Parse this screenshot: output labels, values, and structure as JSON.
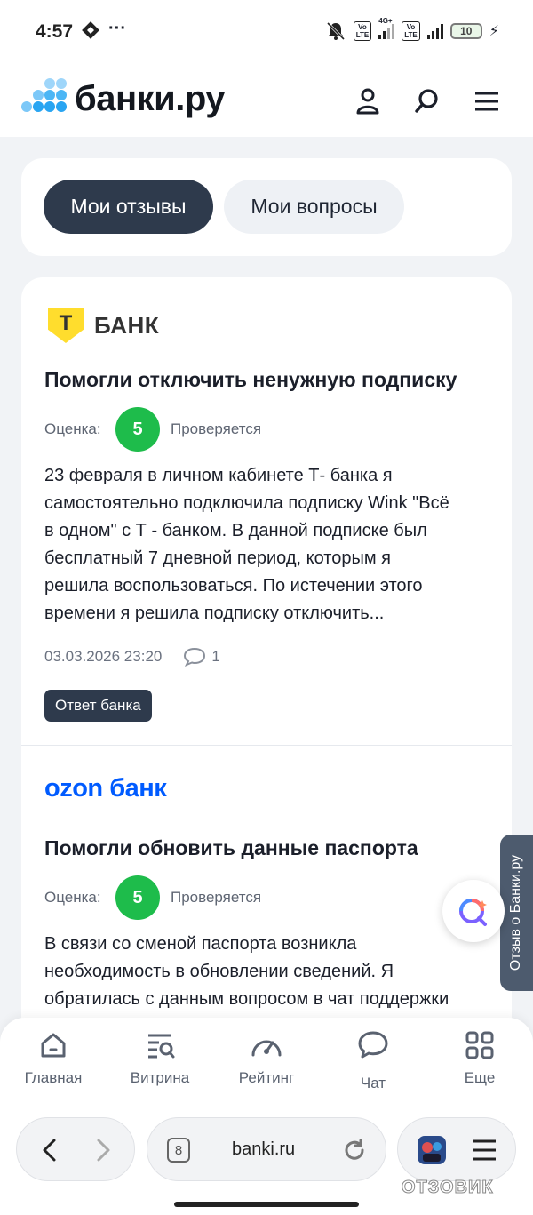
{
  "status_bar": {
    "time": "4:57",
    "dots": "···",
    "battery": "10",
    "network": "4G+"
  },
  "site": {
    "name": "банки.ру"
  },
  "tabs": [
    {
      "label": "Мои отзывы",
      "active": true
    },
    {
      "label": "Мои вопросы",
      "active": false
    }
  ],
  "reviews": [
    {
      "bank_logo": "T-Bank",
      "bank_name": "БАНК",
      "bank_letter": "Т",
      "title": "Помогли отключить ненужную подписку",
      "rating_label": "Оценка:",
      "rating": "5",
      "status": "Проверяется",
      "text_lines": [
        "23 февраля в личном кабинете Т- банка я",
        "самостоятельно подключила подписку Wink \"Всё",
        "в одном\" с Т - банком. В данной подписке был",
        "бесплатный 7 дневной период, которым я",
        "решила воспользоваться. По истечении этого",
        "времени я решила подписку отключить..."
      ],
      "date": "03.03.2026 23:20",
      "comments": "1",
      "badge": "Ответ банка"
    },
    {
      "bank_logo": "ozon банк",
      "title": "Помогли обновить данные паспорта",
      "rating_label": "Оценка:",
      "rating": "5",
      "status": "Проверяется",
      "text_lines": [
        "В связи со сменой паспорта возникла",
        "необходимость в обновлении сведений. Я",
        "обратилась с данным вопросом в чат поддержки"
      ]
    }
  ],
  "side_tab": "Отзыв о Банки.ру",
  "bottom_nav": [
    {
      "label": "Главная",
      "icon": "home-icon"
    },
    {
      "label": "Витрина",
      "icon": "showcase-icon"
    },
    {
      "label": "Рейтинг",
      "icon": "gauge-icon"
    },
    {
      "label": "Чат",
      "icon": "chat-icon"
    },
    {
      "label": "Еще",
      "icon": "grid-icon"
    }
  ],
  "browser": {
    "url": "banki.ru",
    "tab_count": "8"
  },
  "watermark": "ОТЗОВИК",
  "colors": {
    "brand_dark": "#2e3a4c",
    "rating_green": "#1ebc4b",
    "ozon_blue": "#005bff",
    "logo_blue": "#4cb6f5",
    "tbank_yellow": "#ffdd2d"
  }
}
